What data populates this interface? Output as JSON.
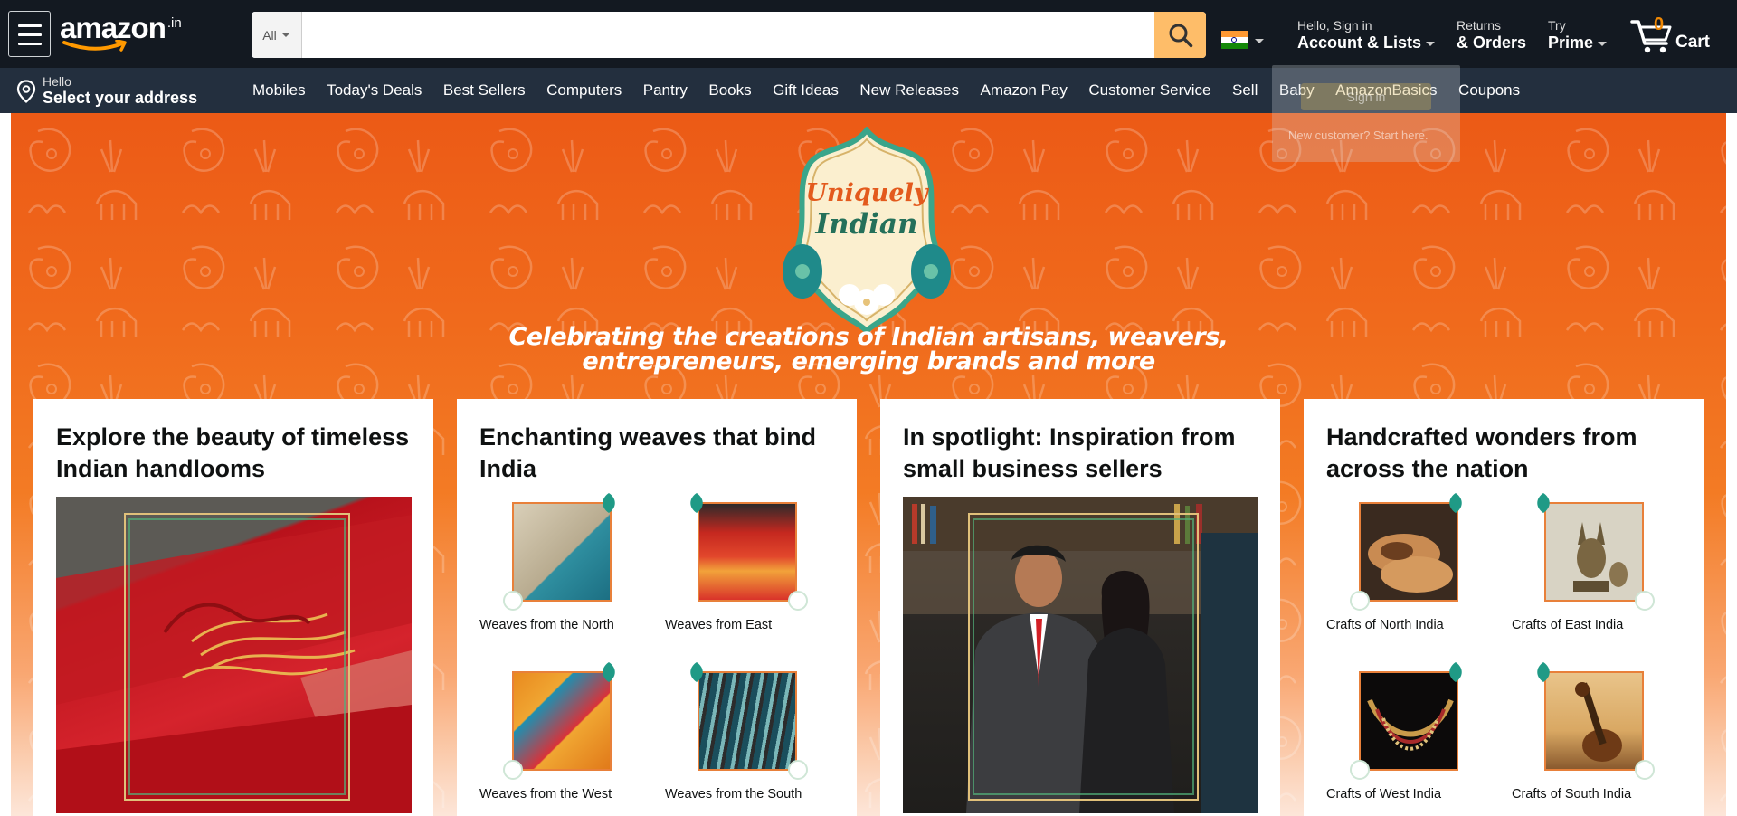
{
  "header": {
    "logo_text": "amazon",
    "logo_suffix": ".in",
    "search": {
      "category": "All",
      "value": "",
      "placeholder": ""
    },
    "account": {
      "line1": "Hello, Sign in",
      "line2": "Account & Lists"
    },
    "returns": {
      "line1": "Returns",
      "line2": "& Orders"
    },
    "prime": {
      "line1": "Try",
      "line2": "Prime"
    },
    "cart": {
      "count": "0",
      "label": "Cart"
    }
  },
  "subnav": {
    "address": {
      "hello": "Hello",
      "select": "Select your address"
    },
    "items": [
      "Mobiles",
      "Today's Deals",
      "Best Sellers",
      "Computers",
      "Pantry",
      "Books",
      "Gift Ideas",
      "New Releases",
      "Amazon Pay",
      "Customer Service",
      "Sell",
      "Baby",
      "AmazonBasics",
      "Coupons"
    ]
  },
  "signin_flyout": {
    "button": "Sign in",
    "new_customer": "New customer? Start here."
  },
  "hero": {
    "badge_line1": "Uniquely",
    "badge_line2": "Indian",
    "tagline_line1": "Celebrating the creations of Indian artisans, weavers,",
    "tagline_line2": "entrepreneurs, emerging brands and more"
  },
  "cards": [
    {
      "title": "Explore the beauty of timeless Indian handlooms"
    },
    {
      "title": "Enchanting weaves that bind India",
      "items": [
        {
          "label": "Weaves from the North"
        },
        {
          "label": "Weaves from East"
        },
        {
          "label": "Weaves from the West"
        },
        {
          "label": "Weaves from the South"
        }
      ]
    },
    {
      "title": "In spotlight: Inspiration from small business sellers"
    },
    {
      "title": "Handcrafted wonders from across the nation",
      "items": [
        {
          "label": "Crafts of North India"
        },
        {
          "label": "Crafts of East India"
        },
        {
          "label": "Crafts of West India"
        },
        {
          "label": "Crafts of South India"
        }
      ]
    }
  ],
  "colors": {
    "nav_bg": "#131921",
    "subnav_bg": "#232f3e",
    "search_button": "#febd69",
    "cart_count": "#f08804",
    "hero_orange": "#ec5a16"
  }
}
